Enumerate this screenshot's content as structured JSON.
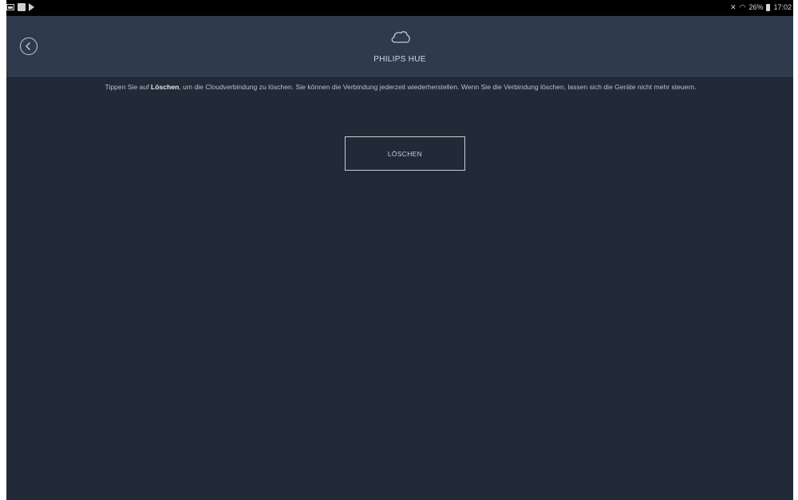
{
  "status_bar": {
    "left_icons": [
      "gallery-icon",
      "app-icon",
      "play-icon"
    ],
    "battery_percent": "26%",
    "time": "17:02"
  },
  "header": {
    "title": "PHILIPS HUE",
    "icon": "cloud-icon",
    "back_icon": "back-arrow-icon"
  },
  "content": {
    "description_pre": "Tippen Sie auf ",
    "description_bold": "Löschen",
    "description_post": ", um die Cloudverbindung zu löschen. Sie können die Verbindung jederzeit wiederherstellen. Wenn Sie die Verbindung löschen, lassen sich die Geräte nicht mehr steuern.",
    "delete_label": "LÖSCHEN"
  },
  "colors": {
    "background": "#222a38",
    "header": "#2f3a4c",
    "text": "#b9c0cc",
    "status_bar": "#000000"
  }
}
